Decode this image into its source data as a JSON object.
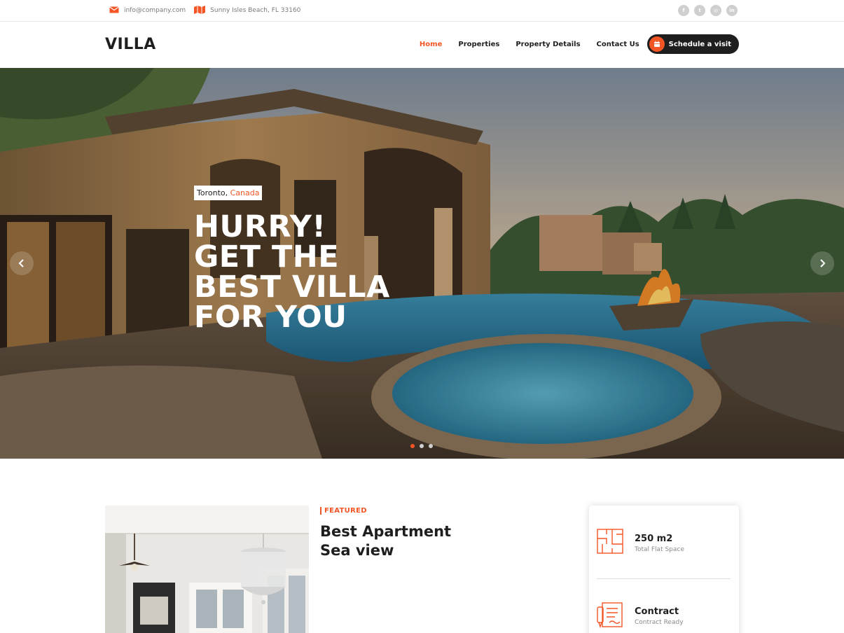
{
  "topbar": {
    "email": "info@company.com",
    "address": "Sunny Isles Beach, FL 33160",
    "email_icon": "envelope-icon",
    "address_icon": "map-icon",
    "social": [
      {
        "icon": "facebook-icon",
        "glyph": "f"
      },
      {
        "icon": "twitter-icon",
        "glyph": "t"
      },
      {
        "icon": "instagram-icon",
        "glyph": "◎"
      },
      {
        "icon": "linkedin-icon",
        "glyph": "in"
      }
    ]
  },
  "header": {
    "logo": "VILLA",
    "nav": [
      "Home",
      "Properties",
      "Property Details",
      "Contact Us"
    ],
    "active": "Home",
    "cta_label": "Schedule a visit",
    "cta_icon": "calendar-icon"
  },
  "hero": {
    "city": "Toronto,",
    "country": "Canada",
    "headline": [
      "HURRY!",
      "GET THE",
      "BEST VILLA",
      "FOR YOU"
    ],
    "active_slide": 1,
    "slide_count": 3
  },
  "featured": {
    "label": "FEATURED",
    "title": [
      "Best Apartment",
      "Sea view"
    ]
  },
  "info": [
    {
      "value": "250 m2",
      "caption": "Total Flat Space",
      "icon": "floor-plan-icon"
    },
    {
      "value": "Contract",
      "caption": "Contract Ready",
      "icon": "contract-icon"
    }
  ],
  "colors": {
    "accent": "#f35525",
    "dark": "#1e1e1e",
    "muted": "#7a7a7a"
  }
}
